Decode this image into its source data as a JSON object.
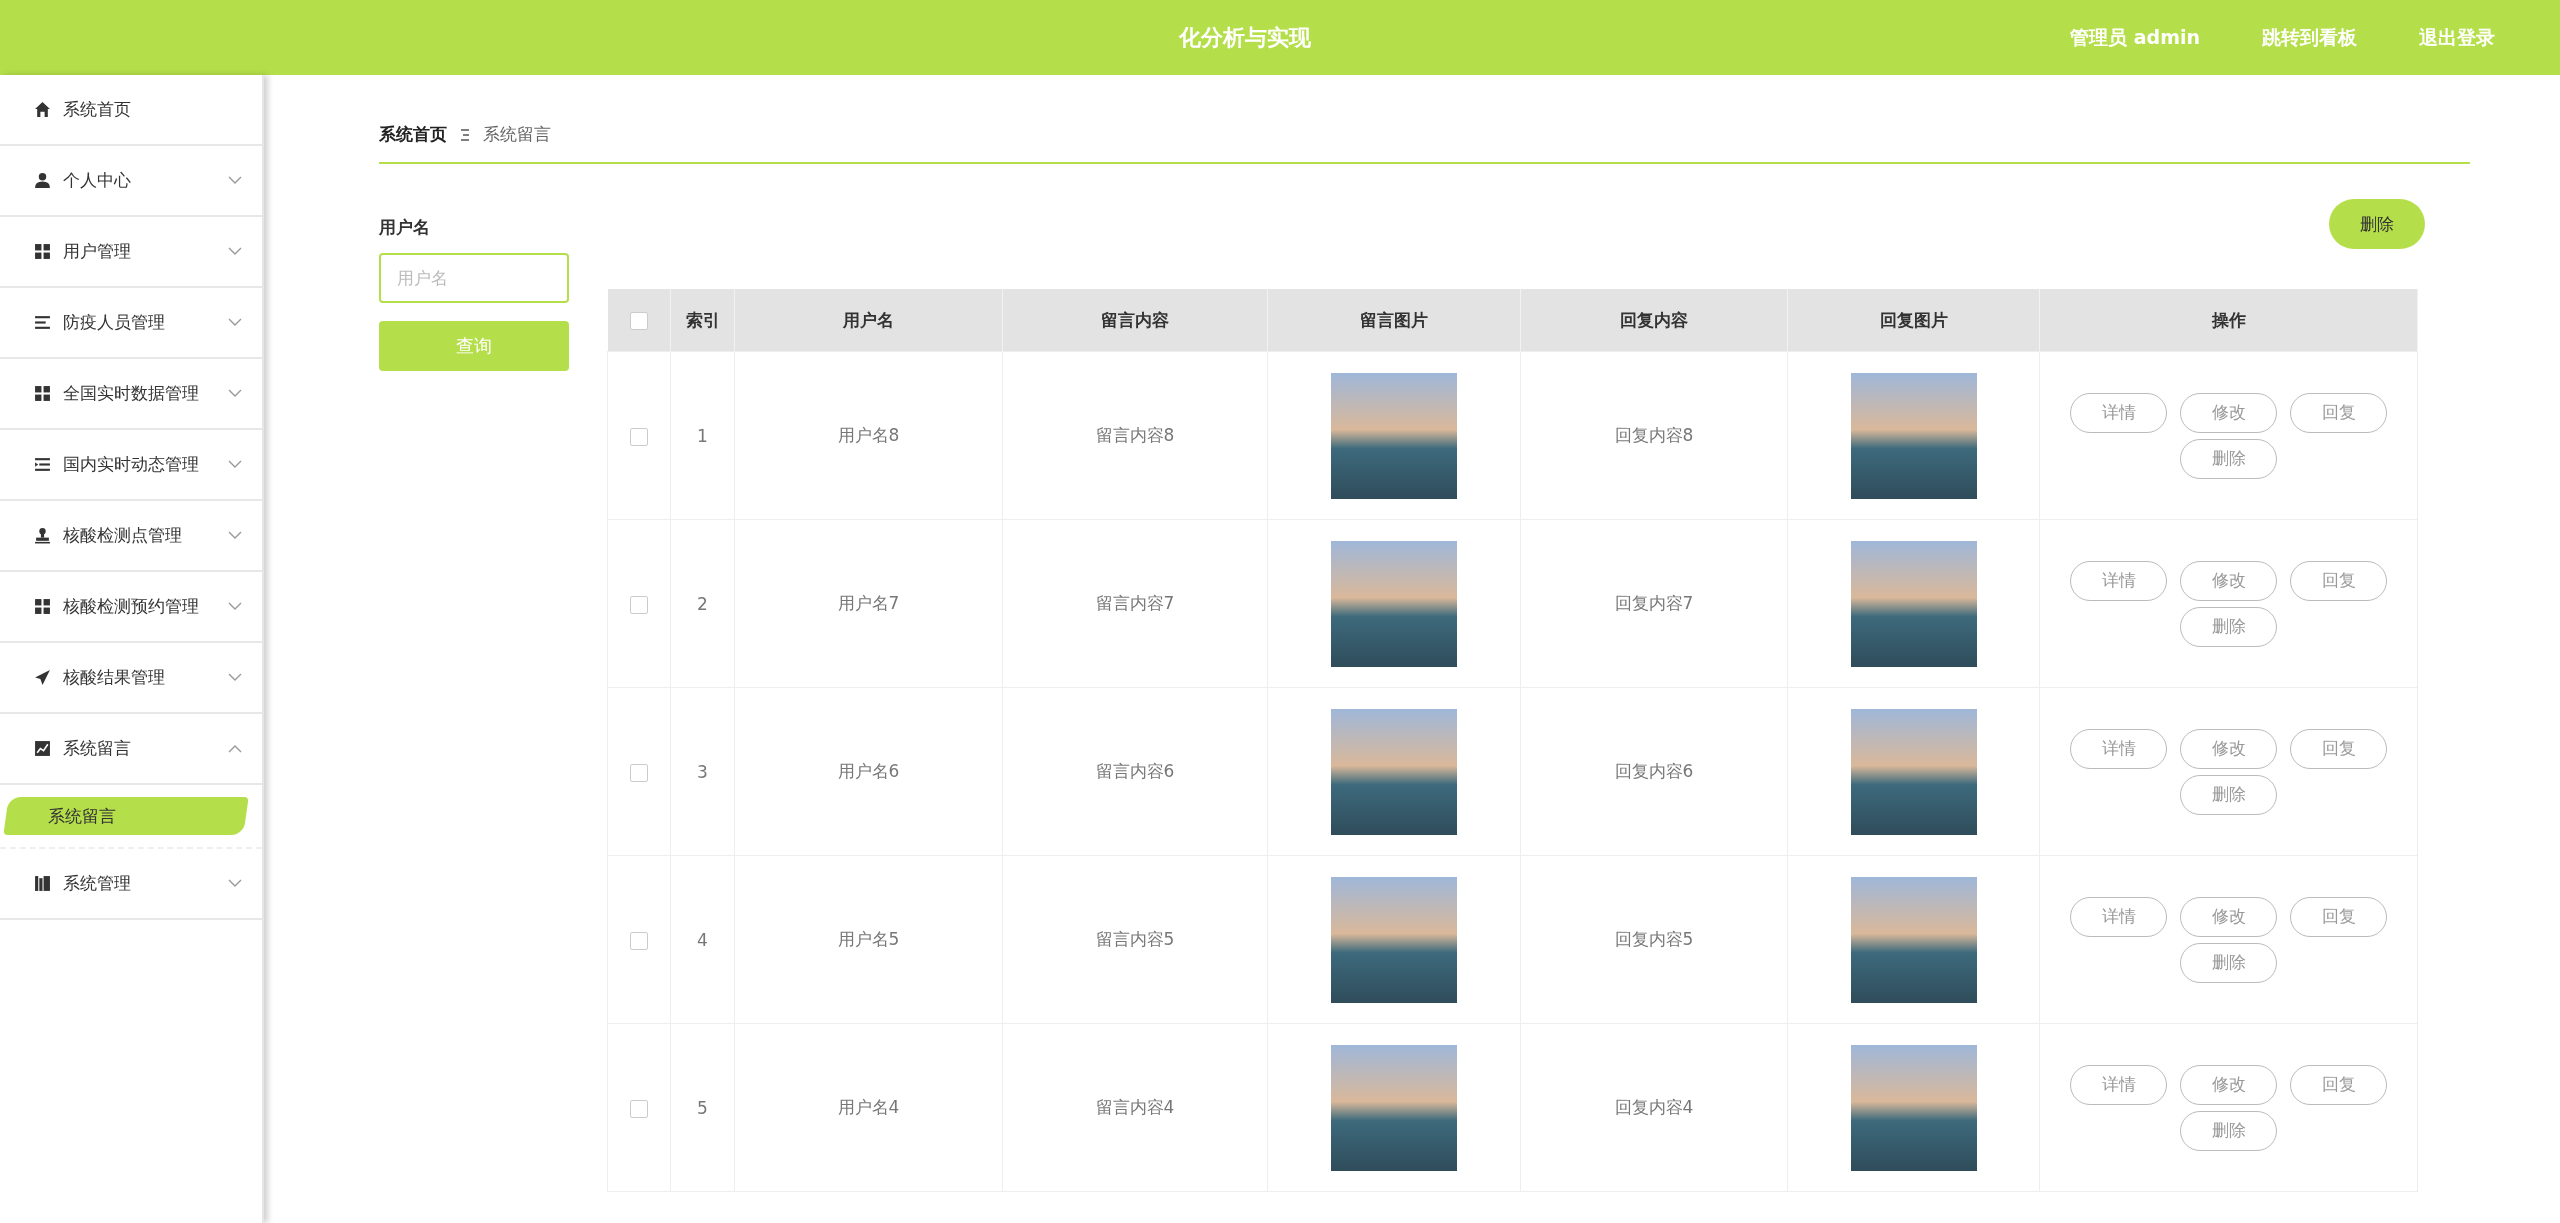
{
  "header": {
    "title": "化分析与实现",
    "links": [
      "管理员 admin",
      "跳转到看板",
      "退出登录"
    ]
  },
  "sidebar": {
    "items": [
      {
        "label": "系统首页",
        "kind": "home"
      },
      {
        "label": "个人中心",
        "kind": "user",
        "expanded": false
      },
      {
        "label": "用户管理",
        "kind": "grid",
        "expanded": false
      },
      {
        "label": "防疫人员管理",
        "kind": "lines",
        "expanded": false
      },
      {
        "label": "全国实时数据管理",
        "kind": "grid",
        "expanded": false
      },
      {
        "label": "国内实时动态管理",
        "kind": "list",
        "expanded": false
      },
      {
        "label": "核酸检测点管理",
        "kind": "stamp",
        "expanded": false
      },
      {
        "label": "核酸检测预约管理",
        "kind": "grid",
        "expanded": false
      },
      {
        "label": "核酸结果管理",
        "kind": "send",
        "expanded": false
      },
      {
        "label": "系统留言",
        "kind": "chart",
        "expanded": true,
        "children": [
          {
            "label": "系统留言",
            "selected": true
          }
        ]
      },
      {
        "label": "系统管理",
        "kind": "books",
        "expanded": false
      }
    ]
  },
  "breadcrumb": [
    "系统首页",
    "系统留言"
  ],
  "search": {
    "label": "用户名",
    "placeholder": "用户名",
    "button": "查询"
  },
  "delete_button": "删除",
  "table": {
    "select_all": {
      "checked": false
    },
    "columns": [
      "索引",
      "用户名",
      "留言内容",
      "留言图片",
      "回复内容",
      "回复图片",
      "操作"
    ],
    "rows": [
      {
        "checked": false,
        "index": "1",
        "username": "用户名8",
        "content": "留言内容8",
        "reply": "回复内容8",
        "actions": [
          "详情",
          "修改",
          "回复",
          "删除"
        ]
      },
      {
        "checked": false,
        "index": "2",
        "username": "用户名7",
        "content": "留言内容7",
        "reply": "回复内容7",
        "actions": [
          "详情",
          "修改",
          "回复",
          "删除"
        ]
      },
      {
        "checked": false,
        "index": "3",
        "username": "用户名6",
        "content": "留言内容6",
        "reply": "回复内容6",
        "actions": [
          "详情",
          "修改",
          "回复",
          "删除"
        ]
      },
      {
        "checked": false,
        "index": "4",
        "username": "用户名5",
        "content": "留言内容5",
        "reply": "回复内容5",
        "actions": [
          "详情",
          "修改",
          "回复",
          "删除"
        ]
      },
      {
        "checked": false,
        "index": "5",
        "username": "用户名4",
        "content": "留言内容4",
        "reply": "回复内容4",
        "actions": [
          "详情",
          "修改",
          "回复",
          "删除"
        ]
      }
    ]
  }
}
